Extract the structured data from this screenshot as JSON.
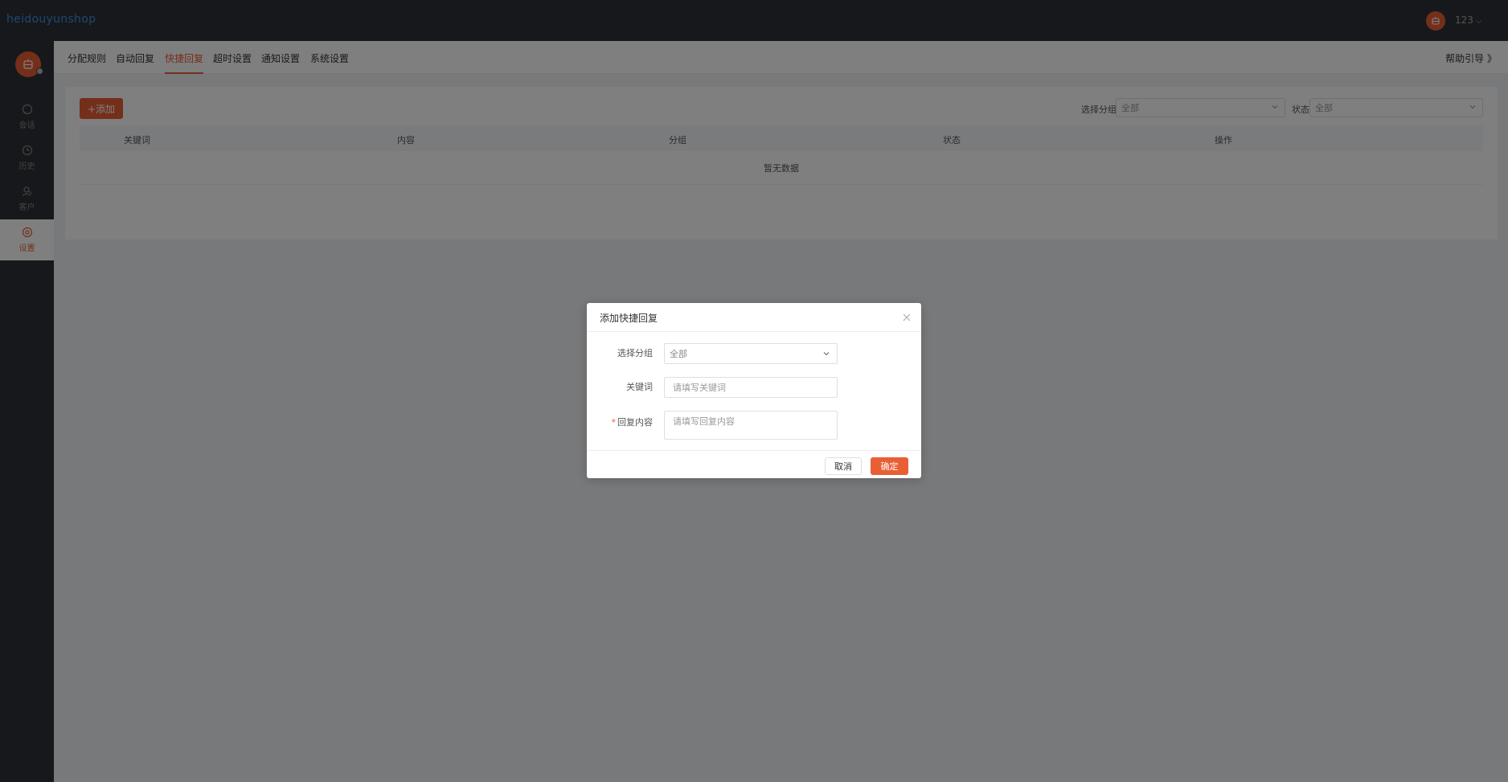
{
  "app": {
    "logo": "heidouyunshop"
  },
  "header": {
    "username": "123"
  },
  "sidebar": {
    "items": [
      {
        "label": "会话",
        "icon": "chat-icon"
      },
      {
        "label": "历史",
        "icon": "clock-icon"
      },
      {
        "label": "客户",
        "icon": "user-search-icon"
      },
      {
        "label": "设置",
        "icon": "settings-icon",
        "active": true
      }
    ]
  },
  "tabs": [
    {
      "label": "分配规则"
    },
    {
      "label": "自动回复"
    },
    {
      "label": "快捷回复",
      "active": true
    },
    {
      "label": "超时设置"
    },
    {
      "label": "通知设置"
    },
    {
      "label": "系统设置"
    }
  ],
  "help_link": "帮助引导 》",
  "toolbar": {
    "add_label": "+添加"
  },
  "filters": {
    "group_label": "选择分组",
    "group_value": "全部",
    "status_label": "状态",
    "status_value": "全部"
  },
  "table": {
    "columns": [
      "关键词",
      "内容",
      "分组",
      "状态",
      "操作"
    ],
    "empty_text": "暂无数据"
  },
  "dialog": {
    "title": "添加快捷回复",
    "group_label": "选择分组",
    "group_value": "全部",
    "keyword_label": "关键词",
    "keyword_placeholder": "请填写关键词",
    "content_required_mark": "*",
    "content_label": "回复内容",
    "content_placeholder": "请填写回复内容",
    "cancel_label": "取消",
    "ok_label": "确定"
  },
  "colors": {
    "accent": "#e95f35",
    "sidebar_bg": "#2f3036",
    "logo": "#3a8ee6"
  }
}
